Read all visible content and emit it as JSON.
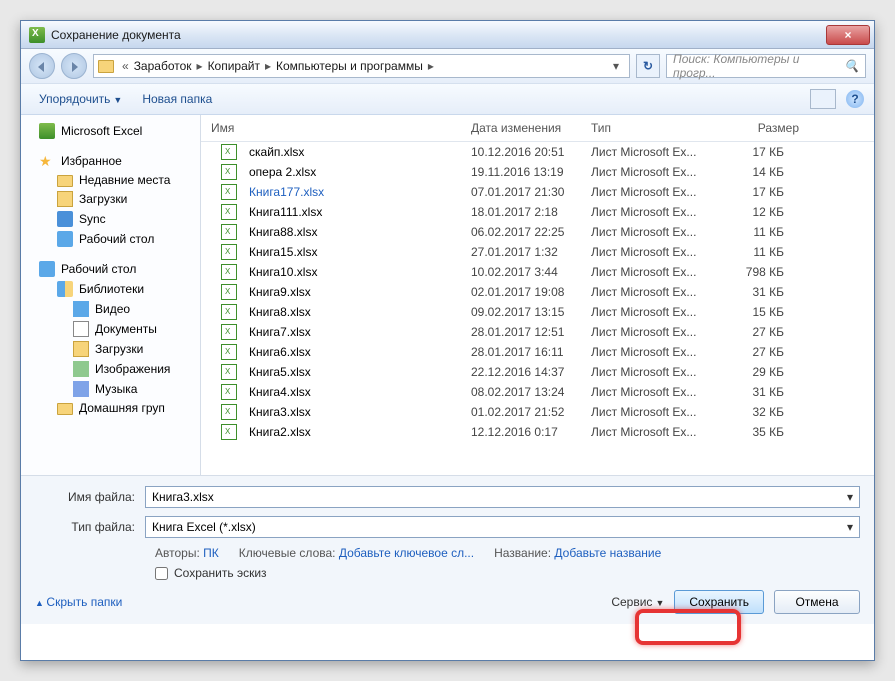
{
  "window": {
    "title": "Сохранение документа"
  },
  "nav": {
    "crumbs": [
      "Заработок",
      "Копирайт",
      "Компьютеры и программы"
    ],
    "search_placeholder": "Поиск: Компьютеры и прогр..."
  },
  "toolbar": {
    "organize": "Упорядочить",
    "new_folder": "Новая папка"
  },
  "sidebar": {
    "excel": "Microsoft Excel",
    "fav": "Избранное",
    "recent": "Недавние места",
    "downloads": "Загрузки",
    "sync": "Sync",
    "desktop1": "Рабочий стол",
    "desktop2": "Рабочий стол",
    "libraries": "Библиотеки",
    "video": "Видео",
    "documents": "Документы",
    "downloads2": "Загрузки",
    "images": "Изображения",
    "music": "Музыка",
    "homegroup": "Домашняя груп"
  },
  "columns": {
    "name": "Имя",
    "date": "Дата изменения",
    "type": "Тип",
    "size": "Размер"
  },
  "files": [
    {
      "name": "скайп.xlsx",
      "date": "10.12.2016 20:51",
      "type": "Лист Microsoft Ex...",
      "size": "17 КБ"
    },
    {
      "name": "опера 2.xlsx",
      "date": "19.11.2016 13:19",
      "type": "Лист Microsoft Ex...",
      "size": "14 КБ"
    },
    {
      "name": "Книга177.xlsx",
      "date": "07.01.2017 21:30",
      "type": "Лист Microsoft Ex...",
      "size": "17 КБ",
      "selected": true
    },
    {
      "name": "Книга111.xlsx",
      "date": "18.01.2017 2:18",
      "type": "Лист Microsoft Ex...",
      "size": "12 КБ"
    },
    {
      "name": "Книга88.xlsx",
      "date": "06.02.2017 22:25",
      "type": "Лист Microsoft Ex...",
      "size": "11 КБ"
    },
    {
      "name": "Книга15.xlsx",
      "date": "27.01.2017 1:32",
      "type": "Лист Microsoft Ex...",
      "size": "11 КБ"
    },
    {
      "name": "Книга10.xlsx",
      "date": "10.02.2017 3:44",
      "type": "Лист Microsoft Ex...",
      "size": "798 КБ"
    },
    {
      "name": "Книга9.xlsx",
      "date": "02.01.2017 19:08",
      "type": "Лист Microsoft Ex...",
      "size": "31 КБ"
    },
    {
      "name": "Книга8.xlsx",
      "date": "09.02.2017 13:15",
      "type": "Лист Microsoft Ex...",
      "size": "15 КБ"
    },
    {
      "name": "Книга7.xlsx",
      "date": "28.01.2017 12:51",
      "type": "Лист Microsoft Ex...",
      "size": "27 КБ"
    },
    {
      "name": "Книга6.xlsx",
      "date": "28.01.2017 16:11",
      "type": "Лист Microsoft Ex...",
      "size": "27 КБ"
    },
    {
      "name": "Книга5.xlsx",
      "date": "22.12.2016 14:37",
      "type": "Лист Microsoft Ex...",
      "size": "29 КБ"
    },
    {
      "name": "Книга4.xlsx",
      "date": "08.02.2017 13:24",
      "type": "Лист Microsoft Ex...",
      "size": "31 КБ"
    },
    {
      "name": "Книга3.xlsx",
      "date": "01.02.2017 21:52",
      "type": "Лист Microsoft Ex...",
      "size": "32 КБ"
    },
    {
      "name": "Книга2.xlsx",
      "date": "12.12.2016 0:17",
      "type": "Лист Microsoft Ex...",
      "size": "35 КБ"
    }
  ],
  "form": {
    "filename_label": "Имя файла:",
    "filename_value": "Книга3.xlsx",
    "filetype_label": "Тип файла:",
    "filetype_value": "Книга Excel (*.xlsx)",
    "authors_label": "Авторы:",
    "authors_value": "ПК",
    "tags_label": "Ключевые слова:",
    "tags_value": "Добавьте ключевое сл...",
    "title_label": "Название:",
    "title_value": "Добавьте название",
    "thumb": "Сохранить эскиз"
  },
  "actions": {
    "hide": "Скрыть папки",
    "tools": "Сервис",
    "save": "Сохранить",
    "cancel": "Отмена"
  }
}
